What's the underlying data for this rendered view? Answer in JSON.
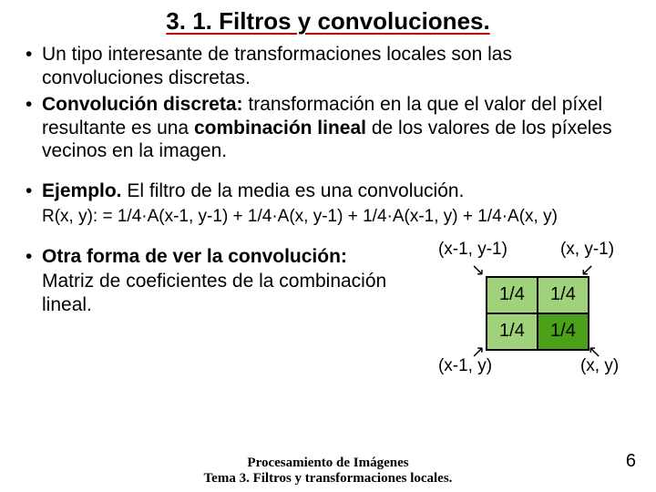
{
  "title": "3. 1. Filtros y convoluciones.",
  "bullets": {
    "b1_a": "Un tipo interesante de transformaciones locales son las convoluciones discretas.",
    "b2_bold": "Convolución discreta:",
    "b2_rest_a": " transformación en la que el valor del píxel resultante es una ",
    "b2_bold2": "combinación lineal",
    "b2_rest_b": " de los valores de los píxeles vecinos en la imagen.",
    "b3_bold": "Ejemplo.",
    "b3_rest": " El filtro de la media es una convolución.",
    "b4_bold": "Otra forma de ver la convolución:",
    "b4_rest_a": "Matriz de coeficientes de la combinación lineal."
  },
  "formula": "R(x, y): = 1/4·A(x-1, y-1) + 1/4·A(x, y-1) + 1/4·A(x-1, y) + 1/4·A(x, y)",
  "matrix": {
    "tl": "(x-1, y-1)",
    "tr": "(x, y-1)",
    "bl": "(x-1, y)",
    "br": "(x, y)",
    "cell": "1/4"
  },
  "footer": {
    "line1": "Procesamiento de Imágenes",
    "line2": "Tema 3. Filtros y transformaciones locales."
  },
  "page": "6"
}
